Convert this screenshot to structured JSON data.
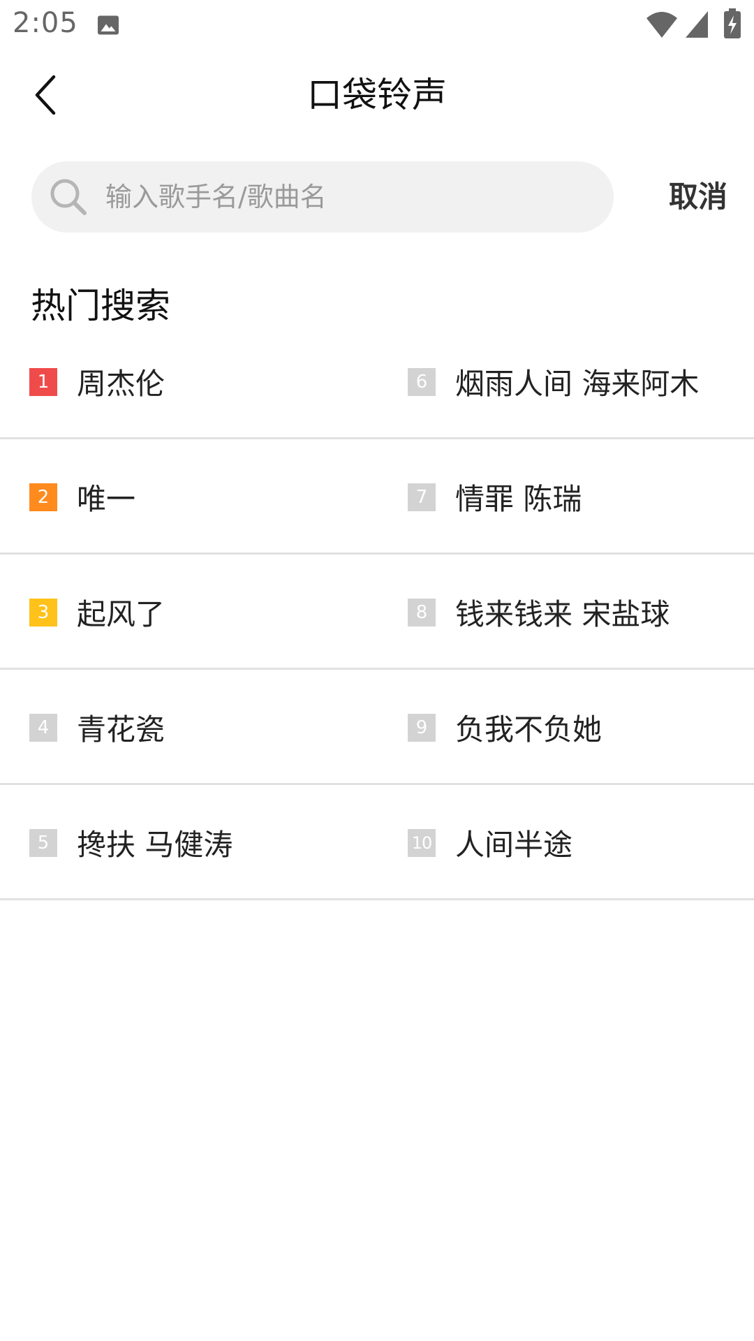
{
  "status_bar": {
    "time": "2:05",
    "icons": [
      "image-icon",
      "wifi-icon",
      "cellular-signal-icon",
      "battery-charging-icon"
    ]
  },
  "header": {
    "title": "口袋铃声",
    "back_icon": "chevron-left-icon"
  },
  "search": {
    "placeholder": "输入歌手名/歌曲名",
    "value": "",
    "cancel_label": "取消",
    "icon": "search-icon"
  },
  "hot_search": {
    "heading": "热门搜索",
    "items": [
      {
        "rank": "1",
        "label": "周杰伦",
        "color": "#f04b4b"
      },
      {
        "rank": "2",
        "label": "唯一",
        "color": "#ff8a1e"
      },
      {
        "rank": "3",
        "label": "起风了",
        "color": "#ffc21a"
      },
      {
        "rank": "4",
        "label": "青花瓷",
        "color": "#d3d3d3"
      },
      {
        "rank": "5",
        "label": "搀扶 马健涛",
        "color": "#d3d3d3"
      },
      {
        "rank": "6",
        "label": "烟雨人间 海来阿木",
        "color": "#d3d3d3"
      },
      {
        "rank": "7",
        "label": "情罪 陈瑞",
        "color": "#d3d3d3"
      },
      {
        "rank": "8",
        "label": "钱来钱来 宋盐球",
        "color": "#d3d3d3"
      },
      {
        "rank": "9",
        "label": "负我不负她",
        "color": "#d3d3d3"
      },
      {
        "rank": "10",
        "label": "人间半途",
        "color": "#d3d3d3"
      }
    ]
  }
}
